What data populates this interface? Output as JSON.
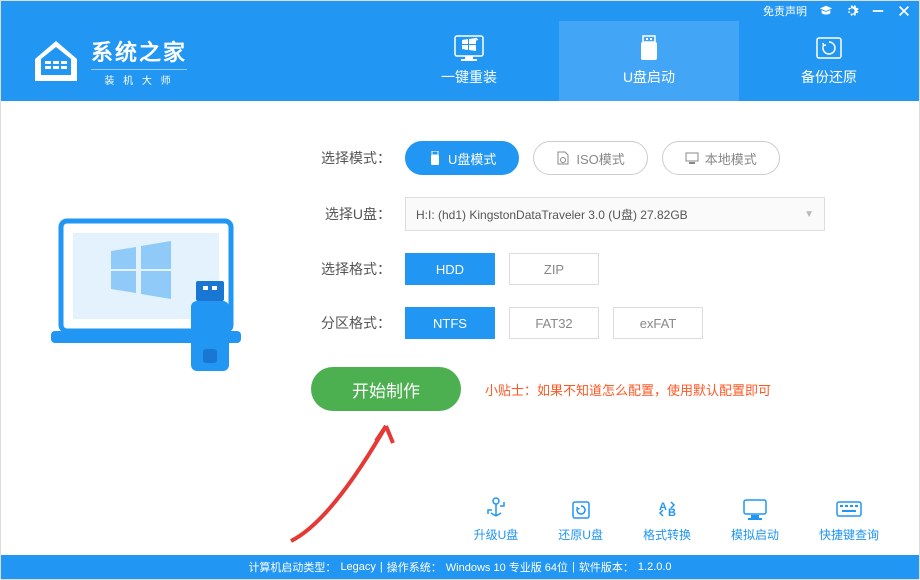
{
  "titlebar": {
    "disclaimer": "免责声明"
  },
  "logo": {
    "title": "系统之家",
    "subtitle": "装 机 大 师"
  },
  "tabs": [
    {
      "label": "一键重装",
      "icon": "windows-reinstall-icon"
    },
    {
      "label": "U盘启动",
      "icon": "usb-boot-icon",
      "active": true
    },
    {
      "label": "备份还原",
      "icon": "backup-restore-icon"
    }
  ],
  "mode": {
    "label": "选择模式：",
    "options": [
      {
        "label": "U盘模式",
        "icon": "usb-icon",
        "active": true
      },
      {
        "label": "ISO模式",
        "icon": "iso-icon"
      },
      {
        "label": "本地模式",
        "icon": "local-icon"
      }
    ]
  },
  "usb_select": {
    "label": "选择U盘：",
    "value": "H:I: (hd1) KingstonDataTraveler 3.0 (U盘) 27.82GB"
  },
  "format": {
    "label": "选择格式：",
    "options": [
      {
        "label": "HDD",
        "active": true
      },
      {
        "label": "ZIP"
      }
    ]
  },
  "partition": {
    "label": "分区格式：",
    "options": [
      {
        "label": "NTFS",
        "active": true
      },
      {
        "label": "FAT32"
      },
      {
        "label": "exFAT"
      }
    ]
  },
  "start": {
    "label": "开始制作"
  },
  "tip": {
    "prefix": "小贴士：",
    "text": "如果不知道怎么配置，使用默认配置即可"
  },
  "tools": [
    {
      "label": "升级U盘"
    },
    {
      "label": "还原U盘"
    },
    {
      "label": "格式转换"
    },
    {
      "label": "模拟启动"
    },
    {
      "label": "快捷键查询"
    }
  ],
  "statusbar": {
    "boot_type_label": "计算机启动类型：",
    "boot_type": "Legacy",
    "os_label": "操作系统：",
    "os": "Windows 10 专业版 64位",
    "version_label": "软件版本：",
    "version": "1.2.0.0"
  }
}
